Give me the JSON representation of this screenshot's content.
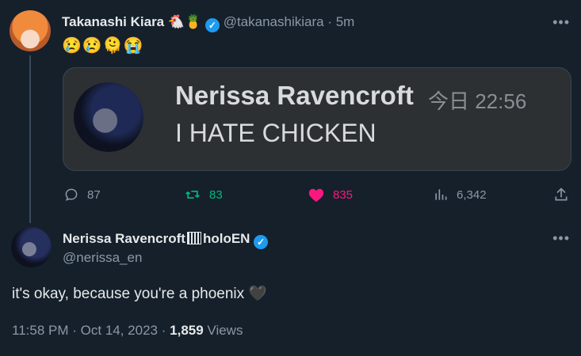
{
  "tweet1": {
    "author_name": "Takanashi Kiara",
    "author_emojis": "🐔🍍",
    "handle": "@takanashikiara",
    "time": "5m",
    "text": "😢😢🫠😭",
    "embedded": {
      "name": "Nerissa Ravencroft",
      "time": "今日 22:56",
      "text": "I HATE CHICKEN"
    },
    "actions": {
      "replies": "87",
      "retweets": "83",
      "likes": "835",
      "views": "6,342"
    }
  },
  "tweet2": {
    "author_name": "Nerissa Ravencroft",
    "author_suffix": "holoEN",
    "handle": "@nerissa_en",
    "text": "it's okay, because you're a phoenix",
    "heart_emoji": "🖤",
    "time": "11:58 PM",
    "date": "Oct 14, 2023",
    "views_count": "1,859",
    "views_label": "Views"
  },
  "colors": {
    "background": "#15202b",
    "retweet_green": "#00ba7c",
    "like_pink": "#f91880",
    "verified_blue": "#1d9bf0",
    "muted": "#8b98a5"
  }
}
